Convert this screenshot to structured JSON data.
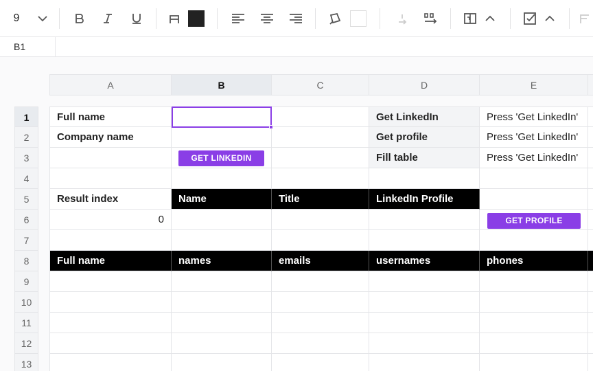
{
  "toolbar": {
    "font_size": "9",
    "fill_color": "#222222",
    "border_color": "#ffffff",
    "icons": [
      "chevron-down-icon",
      "bold-icon",
      "italic-icon",
      "underline-icon",
      "text-color-icon",
      "fill-color-swatch",
      "align-left-icon",
      "align-center-icon",
      "align-right-icon",
      "paint-bucket-icon",
      "color-swatch",
      "insert-row-icon",
      "insert-column-icon",
      "merge-cells-icon",
      "chevron-up-icon",
      "checkbox-icon",
      "chevron-up-icon",
      "text-format-icon"
    ]
  },
  "formula_bar": {
    "cell_ref": "B1",
    "value": ""
  },
  "columns": [
    "A",
    "B",
    "C",
    "D",
    "E"
  ],
  "selected_column": "B",
  "rows": [
    "1",
    "2",
    "3",
    "4",
    "5",
    "6",
    "7",
    "8",
    "9",
    "10",
    "11",
    "12",
    "13"
  ],
  "selected_row": "1",
  "cells": {
    "A1": "Full name",
    "A2": "Company name",
    "A5": "Result index",
    "A6": "0",
    "B5": "Name",
    "C5": "Title",
    "D5": "LinkedIn Profile",
    "D1": "Get LinkedIn",
    "D2": "Get profile",
    "D3": "Fill table",
    "E1": "Press 'Get LinkedIn'",
    "E2": "Press 'Get LinkedIn'",
    "E3": "Press 'Get LinkedIn'",
    "A8": "Full name",
    "B8": "names",
    "C8": "emails",
    "D8": "usernames",
    "E8": "phones"
  },
  "buttons": {
    "get_linkedin": "GET LINKEDIN",
    "get_profile": "GET PROFILE"
  },
  "colors": {
    "accent": "#8a3ee6",
    "header_fill": "#000000",
    "label_fill": "#f3f4f6"
  }
}
